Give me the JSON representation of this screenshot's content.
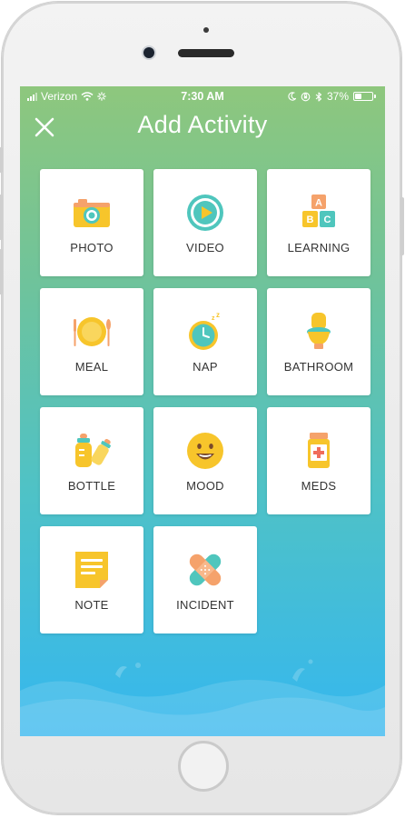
{
  "status_bar": {
    "carrier": "Verizon",
    "time": "7:30 AM",
    "battery": "37%",
    "battery_level": 0.37
  },
  "header": {
    "title": "Add Activity",
    "close_icon": "close-icon"
  },
  "activities": [
    {
      "label": "PHOTO",
      "icon": "camera-icon"
    },
    {
      "label": "VIDEO",
      "icon": "play-icon"
    },
    {
      "label": "LEARNING",
      "icon": "abc-blocks-icon"
    },
    {
      "label": "MEAL",
      "icon": "plate-icon"
    },
    {
      "label": "NAP",
      "icon": "alarm-clock-icon"
    },
    {
      "label": "BATHROOM",
      "icon": "toilet-icon"
    },
    {
      "label": "BOTTLE",
      "icon": "baby-bottle-icon"
    },
    {
      "label": "MOOD",
      "icon": "smiley-icon"
    },
    {
      "label": "MEDS",
      "icon": "medicine-bottle-icon"
    },
    {
      "label": "NOTE",
      "icon": "note-icon"
    },
    {
      "label": "INCIDENT",
      "icon": "bandage-icon"
    }
  ],
  "colors": {
    "gradient_top": "#8ec77d",
    "gradient_bottom": "#35b7ef",
    "icon_yellow": "#f7c52b",
    "icon_teal": "#4fc6bd",
    "icon_orange": "#f5a26b"
  }
}
